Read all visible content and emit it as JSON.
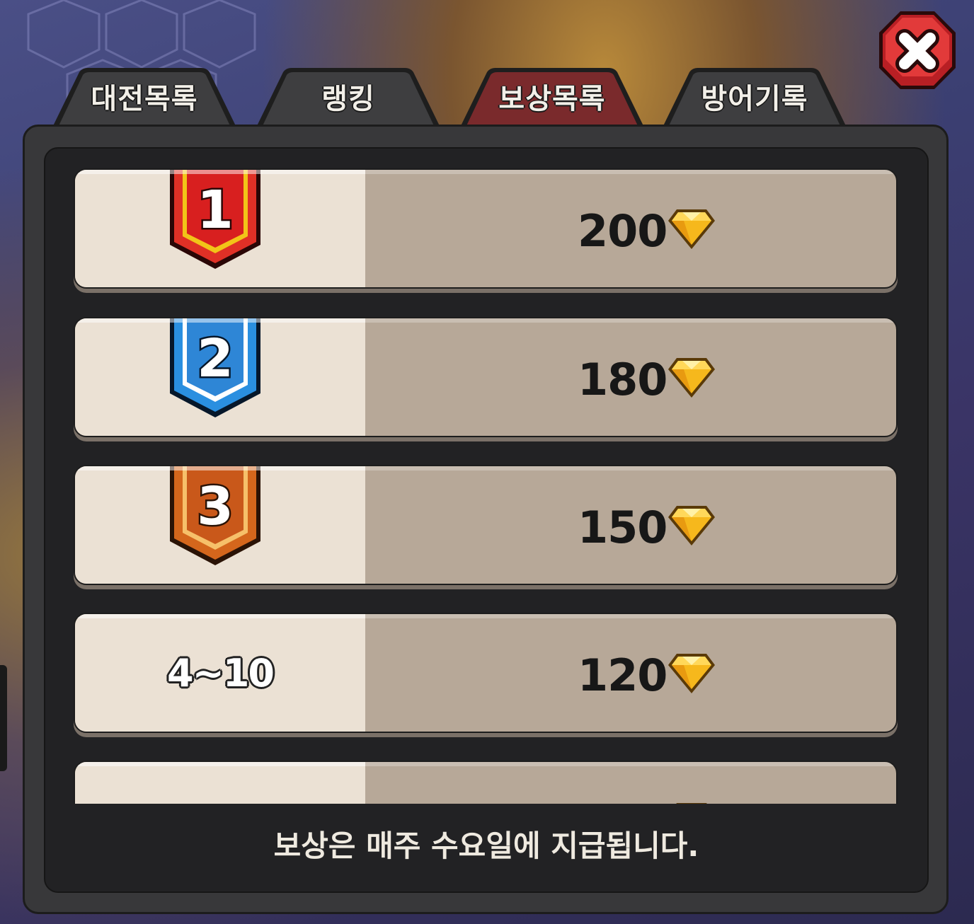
{
  "tabs": [
    {
      "label": "대전목록",
      "active": false
    },
    {
      "label": "랭킹",
      "active": false
    },
    {
      "label": "보상목록",
      "active": true
    },
    {
      "label": "방어기록",
      "active": false
    }
  ],
  "close_button": {
    "icon": "close-x-icon",
    "color": "#d42a2a"
  },
  "rewards": [
    {
      "rank": "1",
      "badge": "rank-1-red-badge",
      "amount": "200",
      "currency_icon": "gem-icon"
    },
    {
      "rank": "2",
      "badge": "rank-2-blue-badge",
      "amount": "180",
      "currency_icon": "gem-icon"
    },
    {
      "rank": "3",
      "badge": "rank-3-orange-badge",
      "amount": "150",
      "currency_icon": "gem-icon"
    },
    {
      "rank": "4~10",
      "badge": null,
      "amount": "120",
      "currency_icon": "gem-icon"
    },
    {
      "rank": "",
      "badge": null,
      "amount": "",
      "currency_icon": "gem-icon"
    }
  ],
  "footer": {
    "note": "보상은 매주 수요일에 지급됩니다."
  },
  "colors": {
    "active_tab": "#7a2a2c",
    "inactive_tab": "#3e3e40",
    "panel": "#38383a",
    "rank_cell": "#ebe1d4",
    "reward_cell": "#b7a898",
    "gem": "#f6b81c"
  }
}
